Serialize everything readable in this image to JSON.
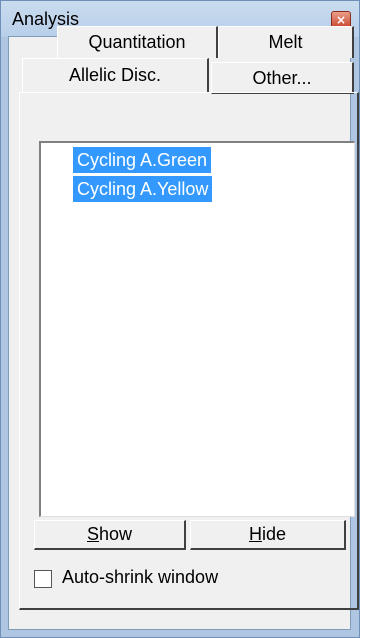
{
  "window": {
    "title": "Analysis",
    "close_glyph": "×"
  },
  "tabs": {
    "row1": [
      {
        "label": "Quantitation"
      },
      {
        "label": "Melt"
      }
    ],
    "row2": [
      {
        "label": "Allelic Disc."
      },
      {
        "label": "Other..."
      }
    ]
  },
  "list": {
    "items": [
      {
        "label": "Cycling A.Green",
        "selected": true
      },
      {
        "label": "Cycling A.Yellow",
        "selected": true
      }
    ]
  },
  "buttons": {
    "show": {
      "label": "Show",
      "mnemonic": "S"
    },
    "hide": {
      "label": "Hide",
      "mnemonic": "H"
    }
  },
  "options": {
    "auto_shrink": {
      "label": "Auto-shrink window",
      "checked": false
    }
  },
  "colors": {
    "selection": "#3399ff",
    "titlebar": "#b8cfea",
    "face": "#f0f0f0"
  }
}
